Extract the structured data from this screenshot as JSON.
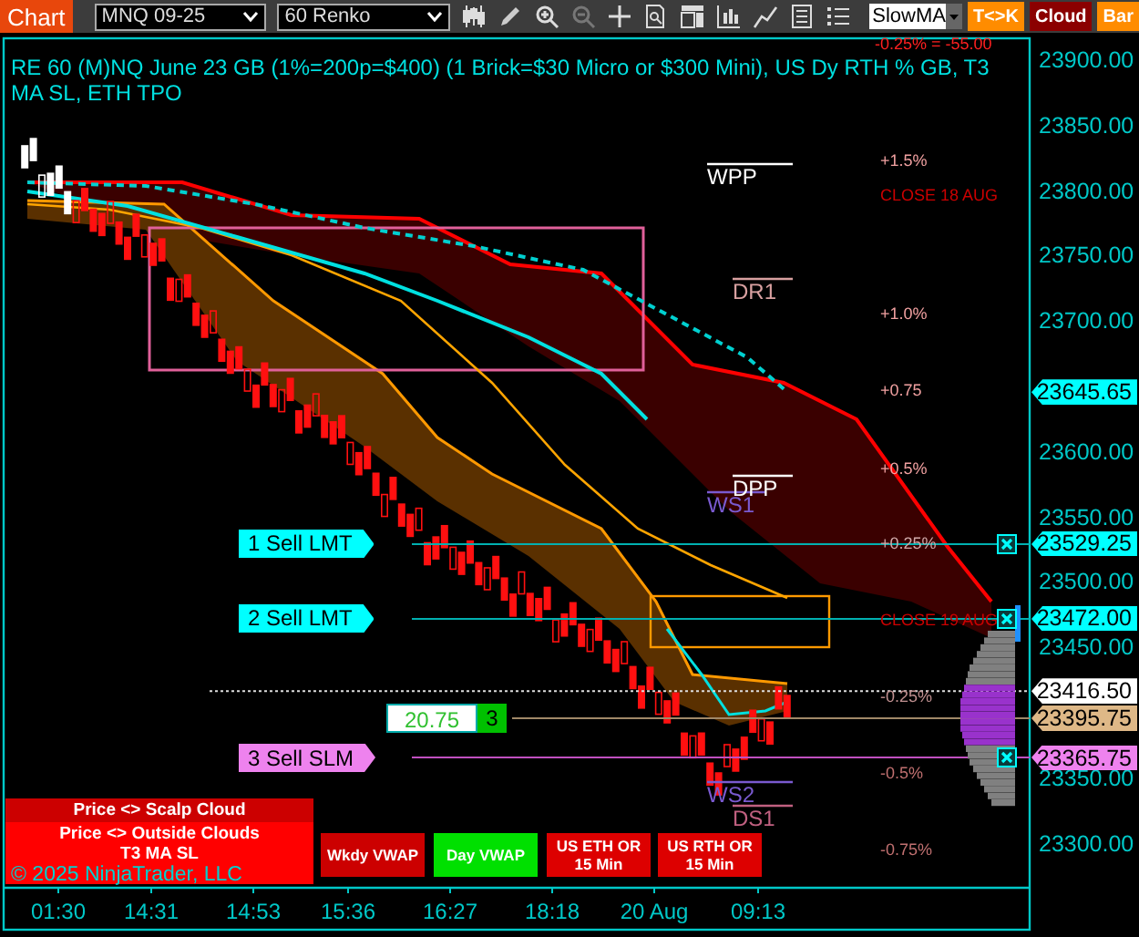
{
  "toolbar": {
    "app_button": "Chart",
    "instrument": "MNQ 09-25",
    "period": "60 Renko",
    "ma_select": "SlowMA",
    "buttons": [
      {
        "label": "T<>K",
        "color": "#ff8c00"
      },
      {
        "label": "Cloud",
        "color": "#8b0000"
      },
      {
        "label": "Bar",
        "color": "#ff8c00"
      }
    ]
  },
  "chart": {
    "title": "RE 60 (M)NQ June 23 GB (1%=200p=$400) (1 Brick=$30 Micro or $300 Mini), US Dy RTH % GB, T3 MA SL, ETH TPO",
    "overlay_text": "-0.25% = -55.00",
    "price_axis": {
      "ticks": [
        "23900.00",
        "23850.00",
        "23800.00",
        "23750.00",
        "23700.00",
        "23600.00",
        "23550.00",
        "23500.00",
        "23450.00",
        "23350.00",
        "23300.00"
      ]
    },
    "price_markers": [
      {
        "label": "23645.65",
        "color": "#00ffff"
      },
      {
        "label": "23529.25",
        "color": "#00ffff"
      },
      {
        "label": "23472.00",
        "color": "#00ffff"
      },
      {
        "label": "23416.50",
        "color": "#ffffff"
      },
      {
        "label": "23395.75",
        "color": "#deb887"
      },
      {
        "label": "23365.75",
        "color": "#ee82ee"
      }
    ],
    "level_labels": [
      {
        "text": "+1.5%",
        "color": "#f0a0a0"
      },
      {
        "text": "CLOSE 18 AUG",
        "color": "#cc0000"
      },
      {
        "text": "+1.0%",
        "color": "#f0a0a0"
      },
      {
        "text": "+0.75",
        "color": "#f0a0a0"
      },
      {
        "text": "+0.5%",
        "color": "#f0a0a0"
      },
      {
        "text": "+0.25%",
        "color": "#d0a8a8"
      },
      {
        "text": "CLOSE 19 AUG",
        "color": "#cc0000"
      },
      {
        "text": "-0.25%",
        "color": "#c09090"
      },
      {
        "text": "-0.5%",
        "color": "#c07070"
      },
      {
        "text": "-0.75%",
        "color": "#c07070"
      }
    ],
    "pivots": [
      {
        "text": "WPP",
        "color": "#ffffff"
      },
      {
        "text": "DR1",
        "color": "#d8a0a0"
      },
      {
        "text": "DPP",
        "color": "#ffffff"
      },
      {
        "text": "WS1",
        "color": "#7a5ad0"
      },
      {
        "text": "WS2",
        "color": "#7a5ad0"
      },
      {
        "text": "DS1",
        "color": "#c06080"
      }
    ],
    "orders": [
      {
        "label": "1 Sell LMT",
        "color": "#00ffff"
      },
      {
        "label": "2 Sell LMT",
        "color": "#00ffff"
      },
      {
        "label": "3 Sell SLM",
        "color": "#ee82ee"
      }
    ],
    "position": {
      "pnl": "20.75",
      "quantity": "3"
    },
    "status_rows": [
      {
        "text": "Price <> Scalp Cloud",
        "color": "#cc0000"
      },
      {
        "text": "Price <> Outside Clouds",
        "color": "#ff0000"
      },
      {
        "text": "T3 MA SL",
        "color": "#ff0000"
      }
    ],
    "indicator_buttons": [
      {
        "label": "Wkdy VWAP",
        "color": "#cc0000"
      },
      {
        "label": "Day VWAP",
        "color": "#00e000"
      },
      {
        "label": "US ETH OR 15 Min",
        "color": "#dd0000"
      },
      {
        "label": "US RTH OR 15 Min",
        "color": "#dd0000"
      }
    ],
    "copyright": "© 2025 NinjaTrader, LLC",
    "time_axis": {
      "labels": [
        "01:30",
        "14:31",
        "14:53",
        "15:36",
        "16:27",
        "18:18",
        "20 Aug",
        "09:13"
      ]
    }
  }
}
